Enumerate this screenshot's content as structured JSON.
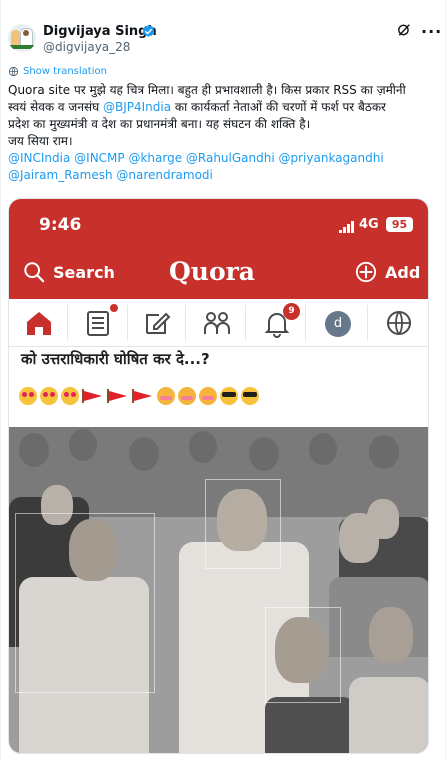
{
  "author": {
    "name": "Digvijaya Singh",
    "handle": "@digvijaya_28"
  },
  "show_translation": "Show translation",
  "post": {
    "line1_a": "Quora site पर मुझे यह चित्र मिला। बहुत ही प्रभावशाली है। किस प्रकार RSS का ज़मीनी",
    "line2_a": "स्वयं सेवक व जनसंघ ",
    "line2_mention": "@BJP4India",
    "line2_b": " का कार्यकर्ता नेताओं की चरणों में फर्श पर बैठकर",
    "line3": "प्रदेश का मुख्यमंत्री व देश का प्रधानमंत्री बना। यह संघटन की शक्ति है।",
    "line4": "जय सिया राम।",
    "mentions_line1": "@INCIndia @INCMP @kharge @RahulGandhi @priyankagandhi",
    "mentions_line2": "@Jairam_Ramesh @narendramodi"
  },
  "quora": {
    "time": "9:46",
    "network": "4G",
    "battery": "95",
    "search_label": "Search",
    "logo": "Quora",
    "add_label": "Add",
    "notification_count": "9",
    "user_initial": "d",
    "heading": "को उत्तराधिकारी घोषित कर दे...?"
  },
  "colors": {
    "accent": "#1d9bf0",
    "quora_red": "#c8302c",
    "text": "#0f1419",
    "muted": "#536471"
  },
  "icons": [
    "verified-icon",
    "grok-icon",
    "more-icon",
    "globe-icon",
    "search-icon",
    "add-icon",
    "home-icon",
    "answer-icon",
    "write-icon",
    "spaces-icon",
    "bell-icon",
    "language-icon"
  ]
}
